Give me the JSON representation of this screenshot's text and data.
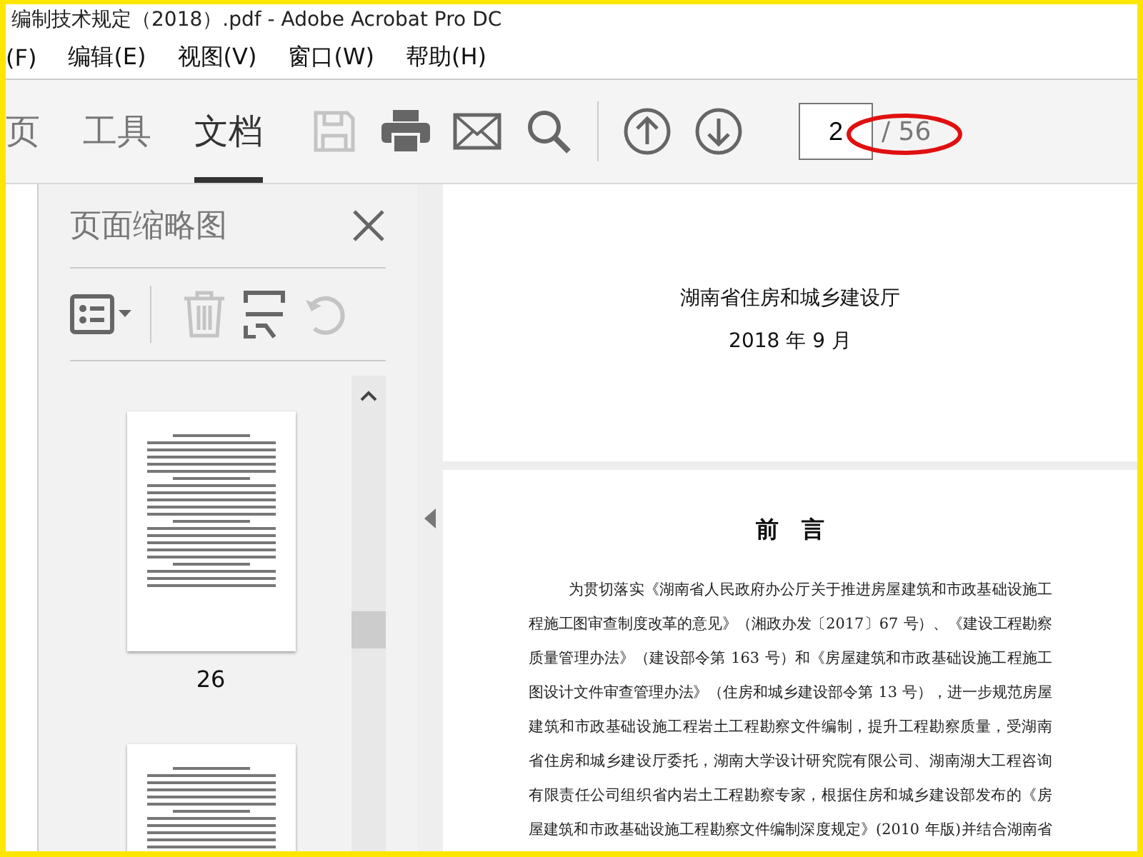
{
  "window": {
    "title": "编制技术规定（2018）.pdf - Adobe Acrobat Pro DC"
  },
  "menu": [
    "(F)",
    "编辑(E)",
    "视图(V)",
    "窗口(W)",
    "帮助(H)"
  ],
  "tabs": [
    {
      "label": "页",
      "selected": false
    },
    {
      "label": "工具",
      "selected": false
    },
    {
      "label": "文档",
      "selected": true
    }
  ],
  "toolbar": {
    "save_disabled": true,
    "page_value": "2",
    "page_total": "/ 56"
  },
  "panel": {
    "title": "页面缩略图",
    "delete_disabled": true,
    "rotate_disabled": true,
    "thumbnails": [
      {
        "kind": "whole",
        "label": "26"
      },
      {
        "kind": "cut"
      }
    ]
  },
  "document": {
    "cover_lines": [
      "湖南省住房和城乡建设厅",
      "2018 年 9 月"
    ],
    "heading": "前　言",
    "paragraph_lines": [
      "为贯切落实《湖南省人民政府办公厅关于推进房屋建筑和市政基础设施工",
      "程施工图审查制度改革的意见》（湘政办发〔2017〕67 号）、《建设工程勘察",
      "质量管理办法》（建设部令第 163 号）和《房屋建筑和市政基础设施工程施工",
      "图设计文件审查管理办法》（住房和城乡建设部令第 13 号），进一步规范房屋",
      "建筑和市政基础设施工程岩土工程勘察文件编制，提升工程勘察质量，受湖南",
      "省住房和城乡建设厅委托，湖南大学设计研究院有限公司、湖南湖大工程咨询",
      "有限责任公司组织省内岩土工程勘察专家，根据住房和城乡建设部发布的《房",
      "屋建筑和市政基础设施工程勘察文件编制深度规定》(2010 年版)并结合湖南省"
    ]
  }
}
